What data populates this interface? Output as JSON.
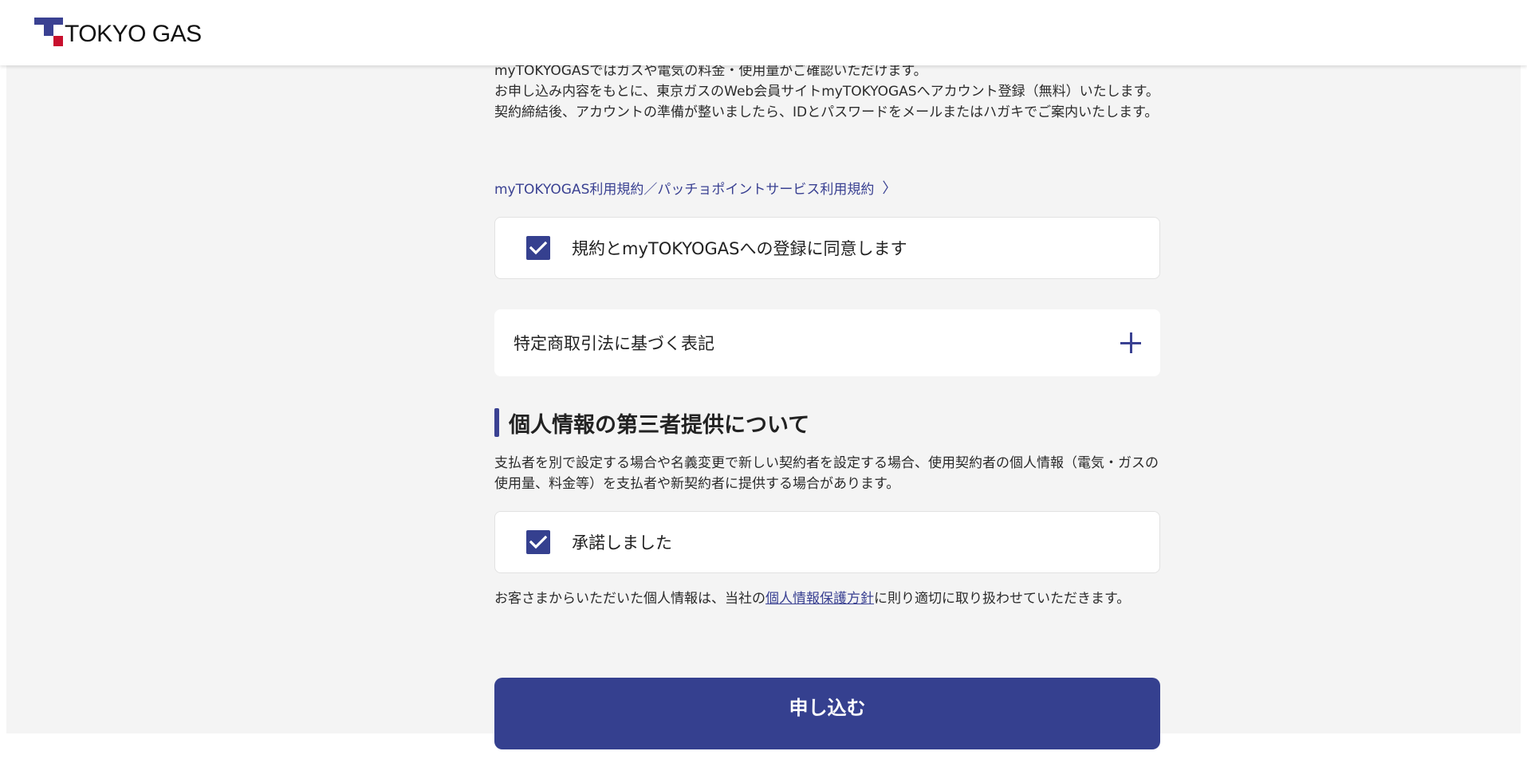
{
  "header": {
    "logo_text": "TOKYO GAS"
  },
  "intro": {
    "line1": "myTOKYOGASではガスや電気の料金・使用量がご確認いただけます。",
    "line2": "お申し込み内容をもとに、東京ガスのWeb会員サイトmyTOKYOGASへアカウント登録（無料）いたします。",
    "line3": "契約締結後、アカウントの準備が整いましたら、IDとパスワードをメールまたはハガキでご案内いたします。"
  },
  "terms": {
    "link_text": "myTOKYOGAS利用規約／パッチョポイントサービス利用規約",
    "link_chevron": "〉",
    "agree_label": "規約とmyTOKYOGASへの登録に同意します",
    "agree_checked": true
  },
  "accordion": {
    "title": "特定商取引法に基づく表記",
    "icon": "plus-icon",
    "expanded": false
  },
  "third_party": {
    "heading": "個人情報の第三者提供について",
    "desc": "支払者を別で設定する場合や名義変更で新しい契約者を設定する場合、使用契約者の個人情報（電気・ガスの使用量、料金等）を支払者や新契約者に提供する場合があります。",
    "consent_label": "承諾しました",
    "consent_checked": true
  },
  "privacy": {
    "prefix": "お客さまからいただいた個人情報は、当社の",
    "link": "個人情報保護方針",
    "suffix": "に則り適切に取り扱わせていただきます。"
  },
  "submit": {
    "label": "申し込む"
  },
  "colors": {
    "brand_navy": "#35408f",
    "brand_red": "#c8102e",
    "background": "#f4f4f4"
  }
}
